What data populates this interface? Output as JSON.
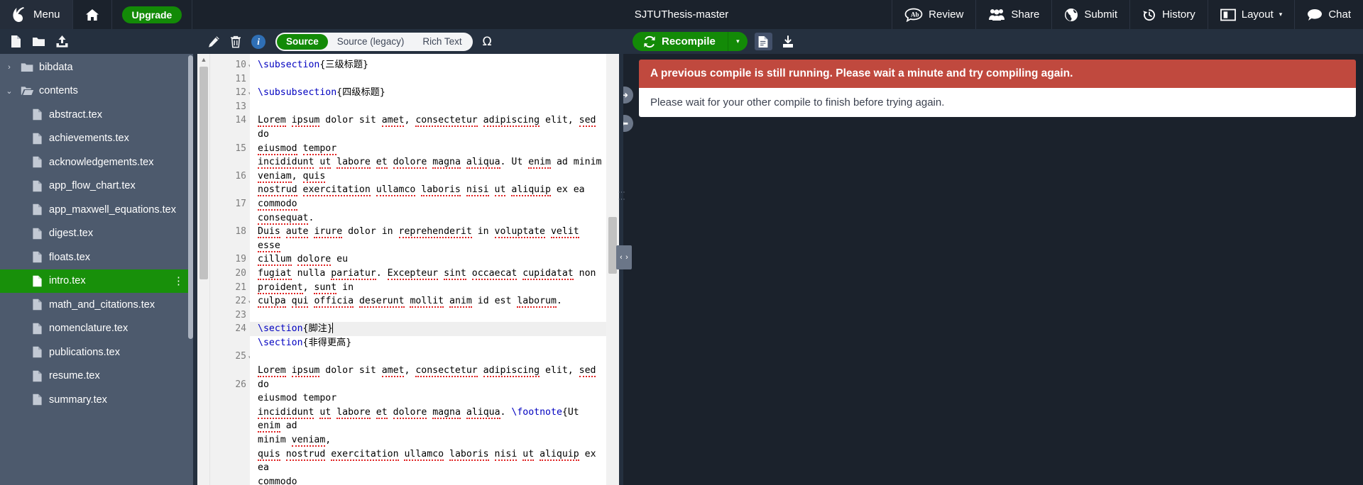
{
  "topnav": {
    "logo_icon": "overleaf-logo-icon",
    "menu_label": "Menu",
    "home_icon": "home-icon",
    "upgrade_label": "Upgrade",
    "project_title": "SJTUThesis-master",
    "right_items": [
      {
        "label": "Review",
        "icon": "review-comment-icon"
      },
      {
        "label": "Share",
        "icon": "share-people-icon"
      },
      {
        "label": "Submit",
        "icon": "submit-globe-icon"
      },
      {
        "label": "History",
        "icon": "history-clock-icon"
      },
      {
        "label": "Layout",
        "icon": "layout-panes-icon",
        "caret": "▾"
      },
      {
        "label": "Chat",
        "icon": "chat-bubble-icon"
      }
    ]
  },
  "file_toolbar": {
    "new_file_icon": "new-file-icon",
    "new_folder_icon": "new-folder-icon",
    "upload_icon": "upload-icon"
  },
  "sidebar": {
    "items": [
      {
        "label": "bibdata",
        "type": "folder",
        "depth": 0,
        "expanded": false,
        "caret": "›",
        "selected": false
      },
      {
        "label": "contents",
        "type": "folder",
        "depth": 0,
        "expanded": true,
        "caret": "⌄",
        "selected": false
      },
      {
        "label": "abstract.tex",
        "type": "file",
        "depth": 1,
        "selected": false
      },
      {
        "label": "achievements.tex",
        "type": "file",
        "depth": 1,
        "selected": false
      },
      {
        "label": "acknowledgements.tex",
        "type": "file",
        "depth": 1,
        "selected": false
      },
      {
        "label": "app_flow_chart.tex",
        "type": "file",
        "depth": 1,
        "selected": false
      },
      {
        "label": "app_maxwell_equations.tex",
        "type": "file",
        "depth": 1,
        "selected": false
      },
      {
        "label": "digest.tex",
        "type": "file",
        "depth": 1,
        "selected": false
      },
      {
        "label": "floats.tex",
        "type": "file",
        "depth": 1,
        "selected": false
      },
      {
        "label": "intro.tex",
        "type": "file",
        "depth": 1,
        "selected": true,
        "menu": "⋮"
      },
      {
        "label": "math_and_citations.tex",
        "type": "file",
        "depth": 1,
        "selected": false
      },
      {
        "label": "nomenclature.tex",
        "type": "file",
        "depth": 1,
        "selected": false
      },
      {
        "label": "publications.tex",
        "type": "file",
        "depth": 1,
        "selected": false
      },
      {
        "label": "resume.tex",
        "type": "file",
        "depth": 1,
        "selected": false
      },
      {
        "label": "summary.tex",
        "type": "file",
        "depth": 1,
        "selected": false
      }
    ]
  },
  "editor_toolbar": {
    "rename_icon": "pencil-rename-icon",
    "delete_icon": "trash-delete-icon",
    "info_icon": "info-icon",
    "info_glyph": "i",
    "modes": [
      {
        "label": "Source",
        "active": true
      },
      {
        "label": "Source (legacy)",
        "active": false
      },
      {
        "label": "Rich Text",
        "active": false
      }
    ],
    "symbol_palette_icon": "omega-symbol-icon",
    "symbol_palette_glyph": "Ω"
  },
  "editor": {
    "lines": [
      {
        "num": "10",
        "fold": "▾",
        "segments": [
          {
            "t": "\\subsection",
            "c": "cmd"
          },
          {
            "t": "{三级标题}",
            "c": "brace"
          }
        ]
      },
      {
        "num": "11",
        "segments": []
      },
      {
        "num": "12",
        "fold": "▾",
        "segments": [
          {
            "t": "\\subsubsection",
            "c": "cmd"
          },
          {
            "t": "{四级标题}",
            "c": "brace"
          }
        ]
      },
      {
        "num": "13",
        "segments": []
      },
      {
        "num": "14",
        "wrap": 2,
        "segments": [
          {
            "t": "Lorem",
            "c": "sp"
          },
          {
            "t": " "
          },
          {
            "t": "ipsum",
            "c": "sp"
          },
          {
            "t": " dolor sit "
          },
          {
            "t": "amet",
            "c": "sp"
          },
          {
            "t": ", "
          },
          {
            "t": "consectetur",
            "c": "sp"
          },
          {
            "t": " "
          },
          {
            "t": "adipiscing",
            "c": "sp"
          },
          {
            "t": " elit, "
          },
          {
            "t": "sed",
            "c": "sp"
          },
          {
            "t": " do\n"
          },
          {
            "t": "eiusmod",
            "c": "sp"
          },
          {
            "t": " "
          },
          {
            "t": "tempor",
            "c": "sp"
          }
        ]
      },
      {
        "num": "15",
        "wrap": 2,
        "segments": [
          {
            "t": "incididunt",
            "c": "sp"
          },
          {
            "t": " "
          },
          {
            "t": "ut",
            "c": "sp"
          },
          {
            "t": " "
          },
          {
            "t": "labore",
            "c": "sp"
          },
          {
            "t": " "
          },
          {
            "t": "et",
            "c": "sp"
          },
          {
            "t": " "
          },
          {
            "t": "dolore",
            "c": "sp"
          },
          {
            "t": " "
          },
          {
            "t": "magna",
            "c": "sp"
          },
          {
            "t": " "
          },
          {
            "t": "aliqua",
            "c": "sp"
          },
          {
            "t": ". Ut "
          },
          {
            "t": "enim",
            "c": "sp"
          },
          {
            "t": " ad minim\n"
          },
          {
            "t": "veniam",
            "c": "sp"
          },
          {
            "t": ", "
          },
          {
            "t": "quis",
            "c": "sp"
          }
        ]
      },
      {
        "num": "16",
        "wrap": 2,
        "segments": [
          {
            "t": "nostrud",
            "c": "sp"
          },
          {
            "t": " "
          },
          {
            "t": "exercitation",
            "c": "sp"
          },
          {
            "t": " "
          },
          {
            "t": "ullamco",
            "c": "sp"
          },
          {
            "t": " "
          },
          {
            "t": "laboris",
            "c": "sp"
          },
          {
            "t": " "
          },
          {
            "t": "nisi",
            "c": "sp"
          },
          {
            "t": " "
          },
          {
            "t": "ut",
            "c": "sp"
          },
          {
            "t": " "
          },
          {
            "t": "aliquip",
            "c": "sp"
          },
          {
            "t": " ex ea "
          },
          {
            "t": "commodo",
            "c": "sp"
          },
          {
            "t": "\n"
          },
          {
            "t": "consequat",
            "c": "sp"
          },
          {
            "t": "."
          }
        ]
      },
      {
        "num": "17",
        "wrap": 2,
        "segments": [
          {
            "t": "Duis",
            "c": "sp"
          },
          {
            "t": " "
          },
          {
            "t": "aute",
            "c": "sp"
          },
          {
            "t": " "
          },
          {
            "t": "irure",
            "c": "sp"
          },
          {
            "t": " dolor in "
          },
          {
            "t": "reprehenderit",
            "c": "sp"
          },
          {
            "t": " in "
          },
          {
            "t": "voluptate",
            "c": "sp"
          },
          {
            "t": " "
          },
          {
            "t": "velit",
            "c": "sp"
          },
          {
            "t": " "
          },
          {
            "t": "esse",
            "c": "sp"
          },
          {
            "t": "\n"
          },
          {
            "t": "cillum",
            "c": "sp"
          },
          {
            "t": " "
          },
          {
            "t": "dolore",
            "c": "sp"
          },
          {
            "t": " eu"
          }
        ]
      },
      {
        "num": "18",
        "wrap": 2,
        "segments": [
          {
            "t": "fugiat",
            "c": "sp"
          },
          {
            "t": " nulla "
          },
          {
            "t": "pariatur",
            "c": "sp"
          },
          {
            "t": ". "
          },
          {
            "t": "Excepteur",
            "c": "sp"
          },
          {
            "t": " "
          },
          {
            "t": "sint",
            "c": "sp"
          },
          {
            "t": " "
          },
          {
            "t": "occaecat",
            "c": "sp"
          },
          {
            "t": " "
          },
          {
            "t": "cupidatat",
            "c": "sp"
          },
          {
            "t": " non\n"
          },
          {
            "t": "proident",
            "c": "sp"
          },
          {
            "t": ", "
          },
          {
            "t": "sunt",
            "c": "sp"
          },
          {
            "t": " in"
          }
        ]
      },
      {
        "num": "19",
        "segments": [
          {
            "t": "culpa",
            "c": "sp"
          },
          {
            "t": " "
          },
          {
            "t": "qui",
            "c": "sp"
          },
          {
            "t": " "
          },
          {
            "t": "officia",
            "c": "sp"
          },
          {
            "t": " "
          },
          {
            "t": "deserunt",
            "c": "sp"
          },
          {
            "t": " "
          },
          {
            "t": "mollit",
            "c": "sp"
          },
          {
            "t": " "
          },
          {
            "t": "anim",
            "c": "sp"
          },
          {
            "t": " id est "
          },
          {
            "t": "laborum",
            "c": "sp"
          },
          {
            "t": "."
          }
        ]
      },
      {
        "num": "20",
        "segments": []
      },
      {
        "num": "21",
        "active": true,
        "segments": [
          {
            "t": "\\section",
            "c": "cmd"
          },
          {
            "t": "{脚注}",
            "c": "brace"
          },
          {
            "t": "",
            "c": "caret"
          }
        ]
      },
      {
        "num": "22",
        "fold": "▾",
        "segments": [
          {
            "t": "\\section",
            "c": "cmd"
          },
          {
            "t": "{非得更高}",
            "c": "brace"
          }
        ]
      },
      {
        "num": "23",
        "segments": []
      },
      {
        "num": "24",
        "wrap": 2,
        "segments": [
          {
            "t": "Lorem",
            "c": "sp"
          },
          {
            "t": " "
          },
          {
            "t": "ipsum",
            "c": "sp"
          },
          {
            "t": " dolor sit "
          },
          {
            "t": "amet",
            "c": "sp"
          },
          {
            "t": ", "
          },
          {
            "t": "consectetur",
            "c": "sp"
          },
          {
            "t": " "
          },
          {
            "t": "adipiscing",
            "c": "sp"
          },
          {
            "t": " elit, "
          },
          {
            "t": "sed",
            "c": "sp"
          },
          {
            "t": " do\n"
          },
          {
            "t": "eiusmod tempor"
          }
        ]
      },
      {
        "num": "25",
        "fold": "▾",
        "wrap": 2,
        "segments": [
          {
            "t": "incididunt",
            "c": "sp"
          },
          {
            "t": " "
          },
          {
            "t": "ut",
            "c": "sp"
          },
          {
            "t": " "
          },
          {
            "t": "labore",
            "c": "sp"
          },
          {
            "t": " "
          },
          {
            "t": "et",
            "c": "sp"
          },
          {
            "t": " "
          },
          {
            "t": "dolore",
            "c": "sp"
          },
          {
            "t": " "
          },
          {
            "t": "magna",
            "c": "sp"
          },
          {
            "t": " "
          },
          {
            "t": "aliqua",
            "c": "sp"
          },
          {
            "t": ". "
          },
          {
            "t": "\\footnote",
            "c": "cmd"
          },
          {
            "t": "{Ut "
          },
          {
            "t": "enim",
            "c": "sp"
          },
          {
            "t": " ad\n"
          },
          {
            "t": "minim "
          },
          {
            "t": "veniam",
            "c": "sp"
          },
          {
            "t": ","
          }
        ]
      },
      {
        "num": "26",
        "wrap": 2,
        "segments": [
          {
            "t": "quis",
            "c": "sp"
          },
          {
            "t": " "
          },
          {
            "t": "nostrud",
            "c": "sp"
          },
          {
            "t": " "
          },
          {
            "t": "exercitation",
            "c": "sp"
          },
          {
            "t": " "
          },
          {
            "t": "ullamco",
            "c": "sp"
          },
          {
            "t": " "
          },
          {
            "t": "laboris",
            "c": "sp"
          },
          {
            "t": " "
          },
          {
            "t": "nisi",
            "c": "sp"
          },
          {
            "t": " "
          },
          {
            "t": "ut",
            "c": "sp"
          },
          {
            "t": " "
          },
          {
            "t": "aliquip",
            "c": "sp"
          },
          {
            "t": " ex ea\n"
          },
          {
            "t": "commodo"
          }
        ]
      }
    ]
  },
  "pdf_panel": {
    "recompile_label": "Recompile",
    "recompile_icon": "refresh-icon",
    "recompile_caret": "▾",
    "logs_icon": "document-logs-icon",
    "download_icon": "download-pdf-icon",
    "alert_title": "A previous compile is still running. Please wait a minute and try compiling again.",
    "alert_body": "Please wait for your other compile to finish before trying again."
  },
  "handles": {
    "expand_right_icon": "arrow-right-icon",
    "collapse_left_icon": "arrow-left-icon",
    "grip_icon": "drag-grip-icon"
  },
  "colors": {
    "nav_bg": "#1b222c",
    "toolbar_bg": "#25303f",
    "sidebar_bg": "#4d5a6d",
    "accent_green": "#138a07",
    "alert_red": "#c0493e",
    "latex_cmd": "#0000c0",
    "spell_underline": "#e02222"
  }
}
